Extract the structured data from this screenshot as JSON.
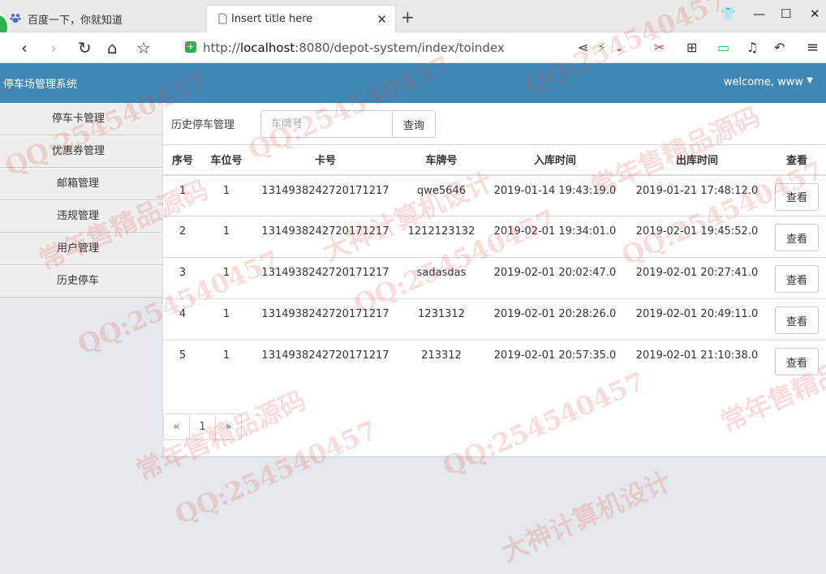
{
  "browser": {
    "tabs": [
      {
        "title": "百度一下，你就知道",
        "active": false,
        "icon": "baidu-paw-icon"
      },
      {
        "title": "Insert title here",
        "active": true,
        "icon": "page-icon"
      }
    ],
    "url_prefix": "http://",
    "url_host": "localhost",
    "url_rest": ":8080/depot-system/index/toindex"
  },
  "header": {
    "title": "停车场管理系统",
    "welcome": "welcome, www"
  },
  "sidebar": {
    "items": [
      {
        "label": "停车卡管理"
      },
      {
        "label": "优惠券管理"
      },
      {
        "label": "邮箱管理"
      },
      {
        "label": "违规管理"
      },
      {
        "label": "用户管理"
      },
      {
        "label": "历史停车"
      }
    ]
  },
  "main": {
    "section_label": "历史停车管理",
    "search_placeholder": "车牌号",
    "search_button": "查询",
    "columns": [
      "序号",
      "车位号",
      "卡号",
      "车牌号",
      "入库时间",
      "出库时间",
      "查看"
    ],
    "rows": [
      {
        "no": "1",
        "slot": "1",
        "card": "1314938242720171217",
        "plate": "qwe5646",
        "in": "2019-01-14 19:43:19.0",
        "out": "2019-01-21 17:48:12.0",
        "action": "查看"
      },
      {
        "no": "2",
        "slot": "1",
        "card": "1314938242720171217",
        "plate": "1212123132",
        "in": "2019-02-01 19:34:01.0",
        "out": "2019-02-01 19:45:52.0",
        "action": "查看"
      },
      {
        "no": "3",
        "slot": "1",
        "card": "1314938242720171217",
        "plate": "sadasdas",
        "in": "2019-02-01 20:02:47.0",
        "out": "2019-02-01 20:27:41.0",
        "action": "查看"
      },
      {
        "no": "4",
        "slot": "1",
        "card": "1314938242720171217",
        "plate": "1231312",
        "in": "2019-02-01 20:28:26.0",
        "out": "2019-02-01 20:49:11.0",
        "action": "查看"
      },
      {
        "no": "5",
        "slot": "1",
        "card": "1314938242720171217",
        "plate": "213312",
        "in": "2019-02-01 20:57:35.0",
        "out": "2019-02-01 21:10:38.0",
        "action": "查看"
      }
    ],
    "pagination": {
      "prev": "«",
      "current": "1",
      "next": "»"
    }
  },
  "watermark": {
    "lines": [
      "QQ:254540457",
      "常年售精品源码",
      "大神计算机设计"
    ],
    "color": "#dc3c3c"
  },
  "colors": {
    "header_bg": "#3f88b6",
    "sidebar_bg": "#eeeeee",
    "page_bg": "#e5e8eb",
    "secure_green": "#2db24a"
  }
}
